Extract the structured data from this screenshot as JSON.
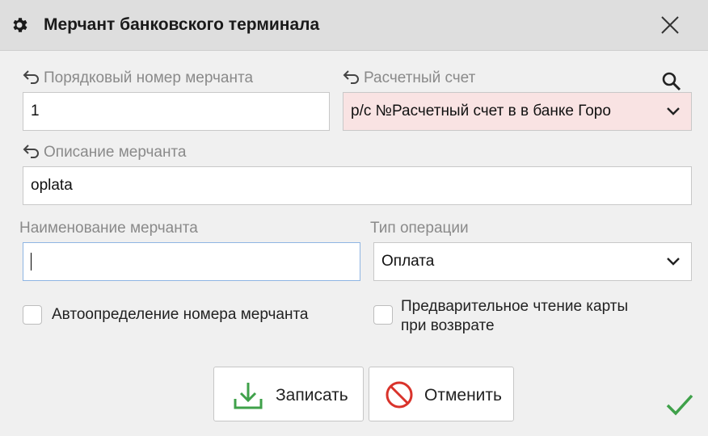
{
  "window": {
    "title": "Мерчант банковского терминала",
    "title_icon": "gear-icon",
    "close_icon": "close-icon"
  },
  "fields": {
    "merchant_number": {
      "label": "Порядковый номер мерчанта",
      "value": "1"
    },
    "settlement_account": {
      "label": "Расчетный счет",
      "value": "р/с №Расчетный счет в в банке Горо"
    },
    "merchant_description": {
      "label": "Описание мерчанта",
      "value": "oplata"
    },
    "merchant_name": {
      "label": "Наименование мерчанта",
      "value": ""
    },
    "operation_type": {
      "label": "Тип операции",
      "value": "Оплата"
    }
  },
  "checkboxes": {
    "auto_detect": {
      "label": "Автоопределение номера мерчанта",
      "checked": false
    },
    "pre_read": {
      "label_line1": "Предварительное чтение карты",
      "label_line2": "при возврате",
      "checked": false
    }
  },
  "buttons": {
    "save": {
      "label": "Записать",
      "icon": "download-icon"
    },
    "cancel": {
      "label": "Отменить",
      "icon": "cancel-icon"
    }
  },
  "colors": {
    "required_bg": "#f9e3e3",
    "focus_border": "#8fb5e3",
    "accent_green": "#3fa14a",
    "cancel_red": "#d9332b"
  }
}
